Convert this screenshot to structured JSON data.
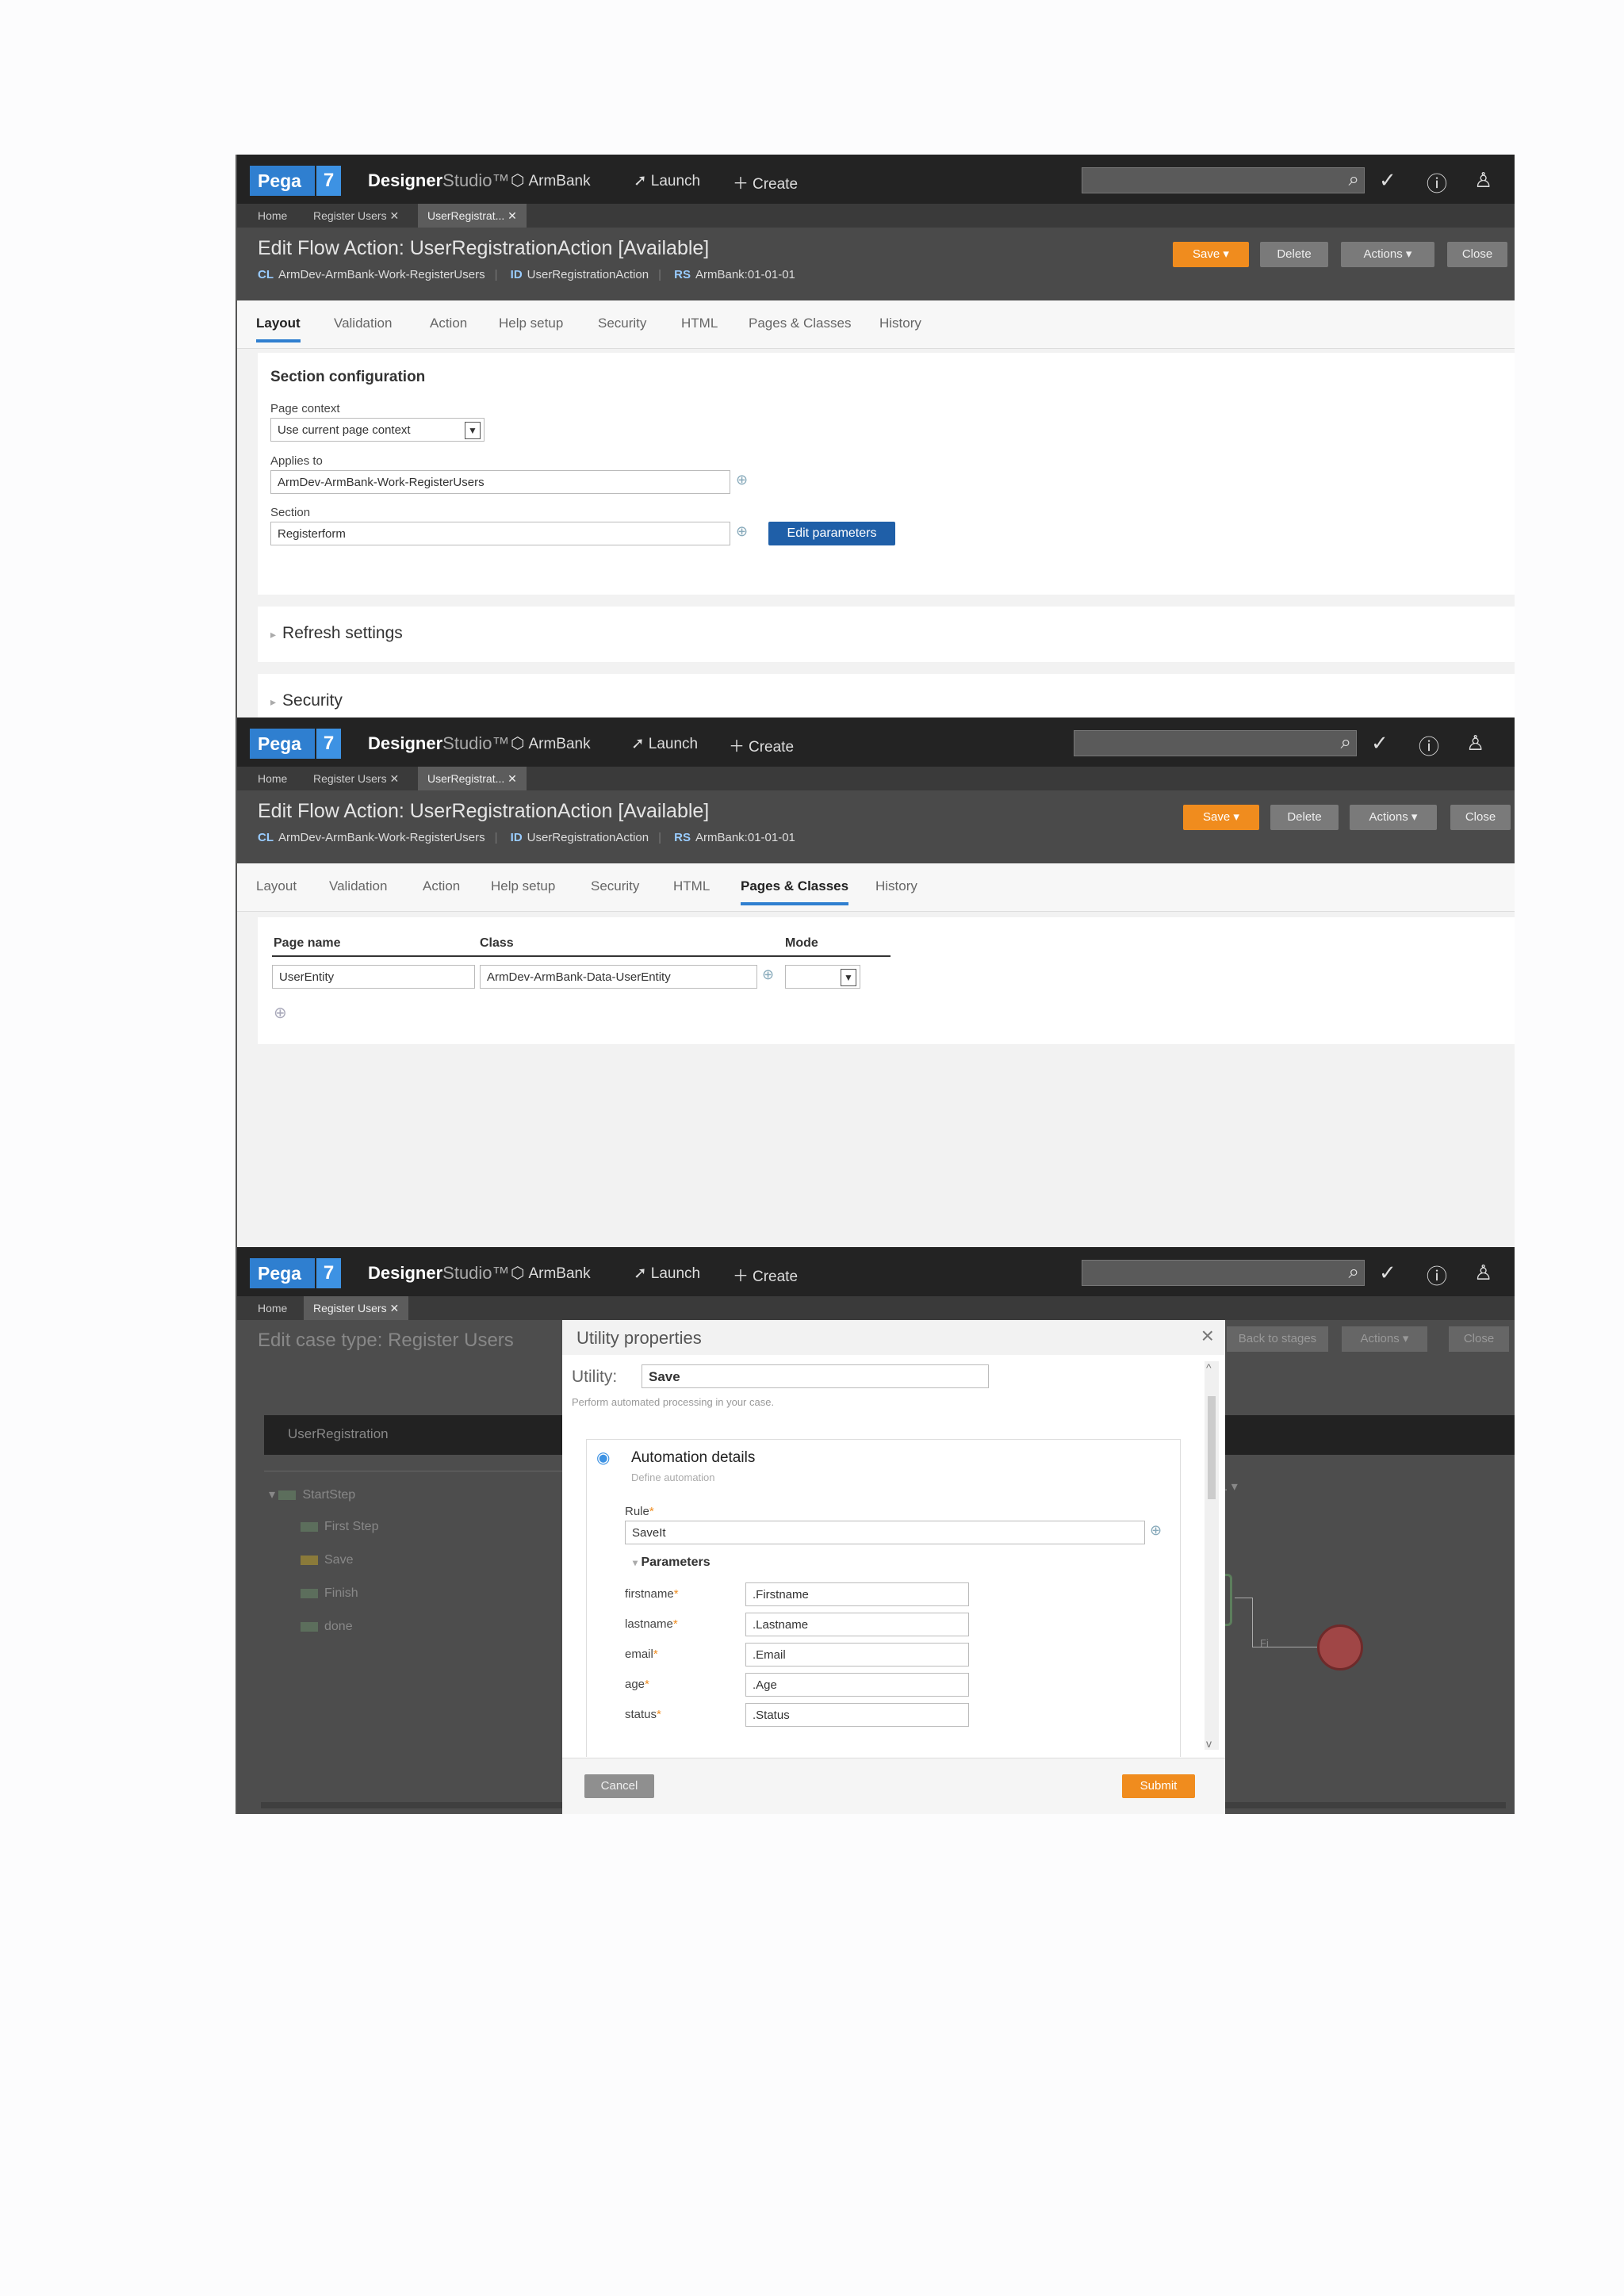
{
  "app": {
    "logo_text": "Pega",
    "logo_version": "7",
    "studio_bold": "Designer",
    "studio_light": "Studio",
    "studio_tm": "™",
    "nav": [
      {
        "label": "ArmBank",
        "icon": "cube-icon"
      },
      {
        "label": "Launch",
        "icon": "rocket-icon"
      },
      {
        "label": "Create",
        "icon": "plus-icon"
      }
    ],
    "top_icons": [
      "checkmark-icon",
      "help-icon",
      "user-icon"
    ]
  },
  "screens": [
    {
      "doc_tabs": [
        {
          "label": "Home",
          "active": false,
          "closable": false
        },
        {
          "label": "Register Users",
          "active": false,
          "closable": true
        },
        {
          "label": "UserRegistrat...",
          "active": true,
          "closable": true
        }
      ],
      "header": {
        "title": "Edit  Flow Action: UserRegistrationAction [Available]",
        "cl_key": "CL",
        "cl_value": "ArmDev-ArmBank-Work-RegisterUsers",
        "id_key": "ID",
        "id_value": "UserRegistrationAction",
        "rs_key": "RS",
        "rs_value": "ArmBank:01-01-01",
        "buttons": [
          "Save",
          "Delete",
          "Actions",
          "Close"
        ]
      },
      "rule_tabs": [
        "Layout",
        "Validation",
        "Action",
        "Help setup",
        "Security",
        "HTML",
        "Pages & Classes",
        "History"
      ],
      "active_rule_tab": "Layout",
      "section_config": {
        "heading": "Section configuration",
        "page_context_label": "Page context",
        "page_context_value": "Use current page context",
        "applies_to_label": "Applies to",
        "applies_to_value": "ArmDev-ArmBank-Work-RegisterUsers",
        "section_label": "Section",
        "section_value": "Registerform",
        "edit_params_label": "Edit parameters"
      },
      "collapsed_sections": [
        "Refresh settings",
        "Security"
      ]
    },
    {
      "doc_tabs": [
        {
          "label": "Home",
          "active": false,
          "closable": false
        },
        {
          "label": "Register Users",
          "active": false,
          "closable": true
        },
        {
          "label": "UserRegistrat...",
          "active": true,
          "closable": true
        }
      ],
      "header": {
        "title": "Edit  Flow Action: UserRegistrationAction [Available]",
        "cl_key": "CL",
        "cl_value": "ArmDev-ArmBank-Work-RegisterUsers",
        "id_key": "ID",
        "id_value": "UserRegistrationAction",
        "rs_key": "RS",
        "rs_value": "ArmBank:01-01-01",
        "buttons": [
          "Save",
          "Delete",
          "Actions",
          "Close"
        ]
      },
      "rule_tabs": [
        "Layout",
        "Validation",
        "Action",
        "Help setup",
        "Security",
        "HTML",
        "Pages & Classes",
        "History"
      ],
      "active_rule_tab": "Pages & Classes",
      "pages_table": {
        "columns": [
          "Page name",
          "Class",
          "Mode"
        ],
        "rows": [
          {
            "page_name": "UserEntity",
            "class": "ArmDev-ArmBank-Data-UserEntity",
            "mode": ""
          }
        ]
      }
    },
    {
      "doc_tabs": [
        {
          "label": "Home",
          "active": false,
          "closable": false
        },
        {
          "label": "Register Users",
          "active": true,
          "closable": true
        }
      ],
      "background": {
        "title": "Edit case type: Register Users",
        "buttons": [
          "Back to stages",
          "Actions",
          "Close"
        ],
        "band_label": "UserRegistration",
        "tree": [
          "StartStep",
          "First Step",
          "Save",
          "Finish",
          "done"
        ],
        "stage_dropdown": "...",
        "connector_label": "Fi"
      },
      "modal": {
        "title": "Utility properties",
        "utility_label": "Utility:",
        "utility_value": "Save",
        "utility_desc": "Perform automated processing in your case.",
        "automation_heading": "Automation details",
        "automation_sub": "Define automation",
        "rule_label": "Rule",
        "rule_value": "SaveIt",
        "parameters_heading": "Parameters",
        "params": [
          {
            "name": "firstname",
            "value": ".Firstname"
          },
          {
            "name": "lastname",
            "value": ".Lastname"
          },
          {
            "name": "email",
            "value": ".Email"
          },
          {
            "name": "age",
            "value": ".Age"
          },
          {
            "name": "status",
            "value": ".Status"
          }
        ],
        "cancel_label": "Cancel",
        "submit_label": "Submit"
      }
    }
  ]
}
